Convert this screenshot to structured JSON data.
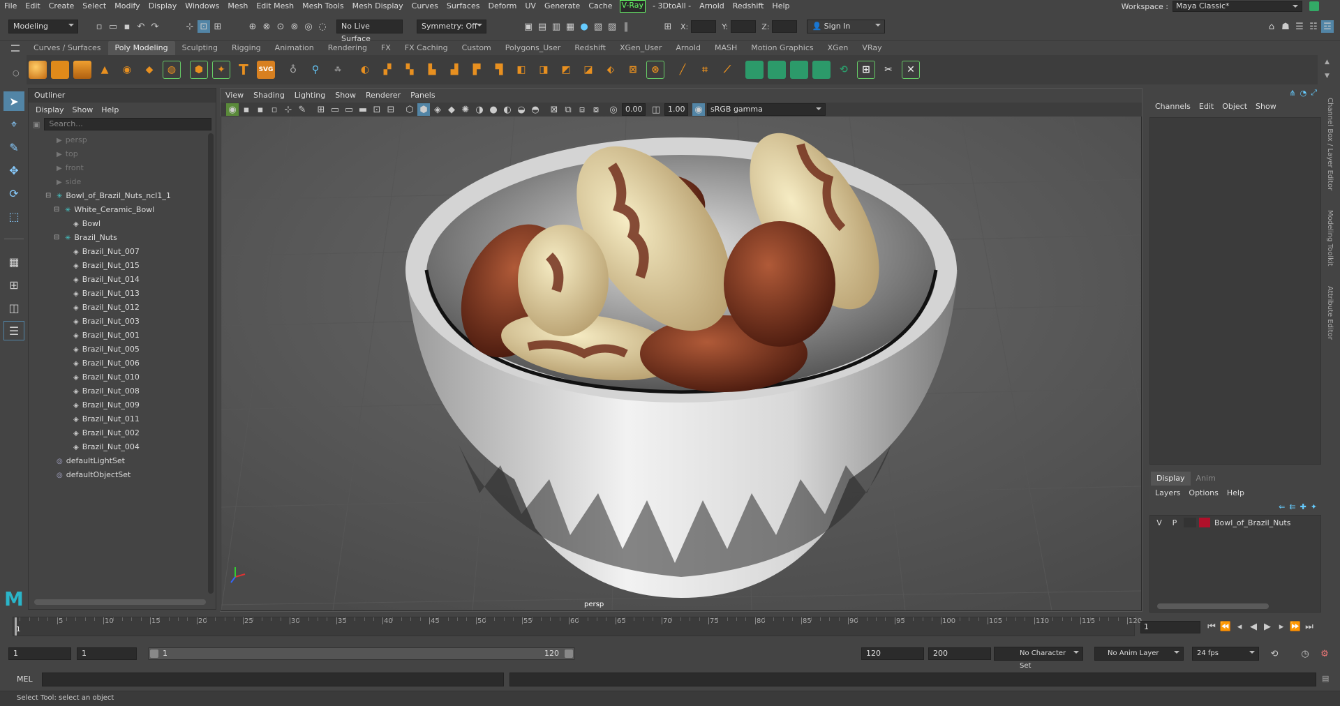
{
  "menubar": {
    "items": [
      "File",
      "Edit",
      "Create",
      "Select",
      "Modify",
      "Display",
      "Windows",
      "Mesh",
      "Edit Mesh",
      "Mesh Tools",
      "Mesh Display",
      "Curves",
      "Surfaces",
      "Deform",
      "UV",
      "Generate",
      "Cache"
    ],
    "vray": "V-Ray",
    "items2": [
      "- 3DtoAll -",
      "Arnold",
      "Redshift",
      "Help"
    ],
    "workspace_label": "Workspace :",
    "workspace_value": "Maya Classic*"
  },
  "status": {
    "mode": "Modeling",
    "live_surface": "No Live Surface",
    "symmetry": "Symmetry: Off",
    "x_label": "X:",
    "y_label": "Y:",
    "z_label": "Z:",
    "sign_in": "Sign In"
  },
  "shelf": {
    "tabs": [
      "Curves / Surfaces",
      "Poly Modeling",
      "Sculpting",
      "Rigging",
      "Animation",
      "Rendering",
      "FX",
      "FX Caching",
      "Custom",
      "Polygons_User",
      "Redshift",
      "XGen_User",
      "Arnold",
      "MASH",
      "Motion Graphics",
      "XGen",
      "VRay"
    ],
    "active_tab": "Poly Modeling",
    "icon_colors": [
      "#e89020",
      "#e89020",
      "#e89020",
      "#e89020",
      "#e89020",
      "#e89020",
      "#e89020",
      "#e89020",
      "#e89020",
      "#e89020",
      "#e89020"
    ]
  },
  "outliner": {
    "title": "Outliner",
    "menu": [
      "Display",
      "Show",
      "Help"
    ],
    "search_placeholder": "Search...",
    "cameras": [
      "persp",
      "top",
      "front",
      "side"
    ],
    "root": "Bowl_of_Brazil_Nuts_ncl1_1",
    "group1": "White_Ceramic_Bowl",
    "bowl": "Bowl",
    "group2": "Brazil_Nuts",
    "nuts": [
      "Brazil_Nut_007",
      "Brazil_Nut_015",
      "Brazil_Nut_014",
      "Brazil_Nut_013",
      "Brazil_Nut_012",
      "Brazil_Nut_003",
      "Brazil_Nut_001",
      "Brazil_Nut_005",
      "Brazil_Nut_006",
      "Brazil_Nut_010",
      "Brazil_Nut_008",
      "Brazil_Nut_009",
      "Brazil_Nut_011",
      "Brazil_Nut_002",
      "Brazil_Nut_004"
    ],
    "sets": [
      "defaultLightSet",
      "defaultObjectSet"
    ]
  },
  "viewport": {
    "menu": [
      "View",
      "Shading",
      "Lighting",
      "Show",
      "Renderer",
      "Panels"
    ],
    "value1": "0.00",
    "value2": "1.00",
    "colorspace": "sRGB gamma",
    "camera_label": "persp"
  },
  "channel": {
    "menu": [
      "Channels",
      "Edit",
      "Object",
      "Show"
    ],
    "tabs": [
      "Display",
      "Anim"
    ],
    "layer_menu": [
      "Layers",
      "Options",
      "Help"
    ],
    "layer_v": "V",
    "layer_p": "P",
    "layer_name": "Bowl_of_Brazil_Nuts",
    "layer_color": "#b0102a"
  },
  "right_tabs": [
    "Channel Box / Layer Editor",
    "Modeling Toolkit",
    "Attribute Editor"
  ],
  "timeline": {
    "ticks": [
      "5",
      "10",
      "15",
      "20",
      "25",
      "30",
      "35",
      "40",
      "45",
      "50",
      "55",
      "60",
      "65",
      "70",
      "75",
      "80",
      "85",
      "90",
      "95",
      "100",
      "105",
      "110",
      "115",
      "120"
    ],
    "current": "1",
    "frame_field": "1"
  },
  "range": {
    "start": "1",
    "start2": "1",
    "slider_start": "1",
    "slider_end": "120",
    "end": "120",
    "end2": "200",
    "char_set": "No Character Set",
    "anim_layer": "No Anim Layer",
    "fps": "24 fps"
  },
  "cmd": {
    "label": "MEL"
  },
  "help": {
    "text": "Select Tool: select an object"
  }
}
